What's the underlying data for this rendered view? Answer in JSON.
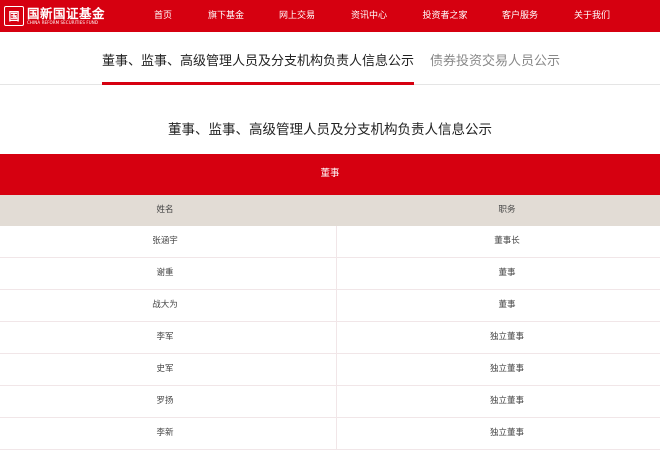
{
  "brand": {
    "name_cn": "国新国证基金",
    "name_en": "CHINA REFORM SECURITIES FUND",
    "accent_color": "#d60010"
  },
  "nav": [
    {
      "label": "首页"
    },
    {
      "label": "旗下基金"
    },
    {
      "label": "网上交易"
    },
    {
      "label": "资讯中心"
    },
    {
      "label": "投资者之家"
    },
    {
      "label": "客户服务"
    },
    {
      "label": "关于我们"
    }
  ],
  "tabs": [
    {
      "label": "董事、监事、高级管理人员及分支机构负责人信息公示",
      "active": true
    },
    {
      "label": "债券投资交易人员公示",
      "active": false
    }
  ],
  "page_title": "董事、监事、高级管理人员及分支机构负责人信息公示",
  "section": {
    "title": "董事",
    "columns": [
      "姓名",
      "职务"
    ],
    "rows": [
      {
        "name": "张涵宇",
        "position": "董事长"
      },
      {
        "name": "谢重",
        "position": "董事"
      },
      {
        "name": "战大为",
        "position": "董事"
      },
      {
        "name": "李军",
        "position": "独立董事"
      },
      {
        "name": "史军",
        "position": "独立董事"
      },
      {
        "name": "罗扬",
        "position": "独立董事"
      },
      {
        "name": "李新",
        "position": "独立董事"
      }
    ]
  }
}
